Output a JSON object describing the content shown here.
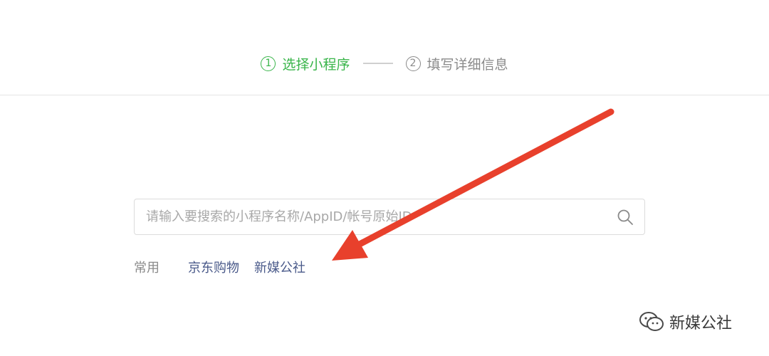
{
  "steps": {
    "step1": {
      "number": "1",
      "label": "选择小程序",
      "color": "#39b54a"
    },
    "step2": {
      "number": "2",
      "label": "填写详细信息"
    }
  },
  "search": {
    "placeholder": "请输入要搜索的小程序名称/AppID/帐号原始ID",
    "icon": "search-icon"
  },
  "common": {
    "label": "常用",
    "items": [
      "京东购物",
      "新媒公社"
    ]
  },
  "annotation": {
    "arrow_color": "#e8402c"
  },
  "watermark": {
    "icon": "wechat-icon",
    "text": "新媒公社"
  }
}
